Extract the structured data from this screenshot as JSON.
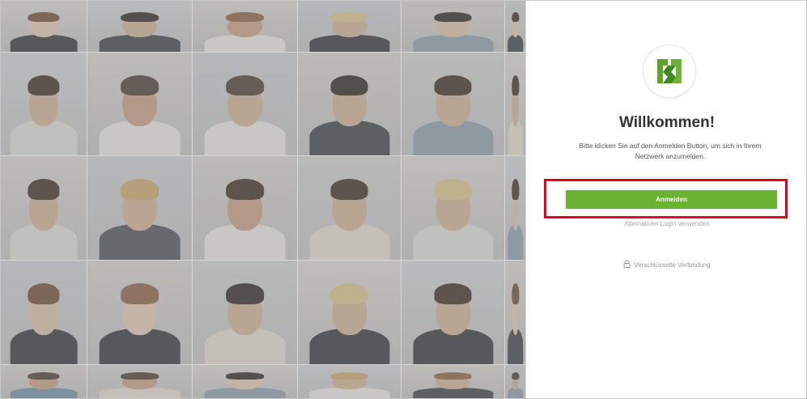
{
  "colors": {
    "accent_green": "#6cb333",
    "highlight_red": "#e3001b",
    "title_text": "#333333",
    "muted_text": "#a9a9a9"
  },
  "welcome": {
    "title": "Willkommen!",
    "text": "Bitte klicken Sie auf den Anmelden Button, um sich in Ihrem Netzwerk anzumelden."
  },
  "login": {
    "button_label": "Anmelden",
    "alternative_link": "Alternativen Login verwenden"
  },
  "security": {
    "icon": "lock-icon",
    "label": "Verschlüsselte Verbindung"
  },
  "branding": {
    "logo_icon": "company-logo-icon"
  }
}
